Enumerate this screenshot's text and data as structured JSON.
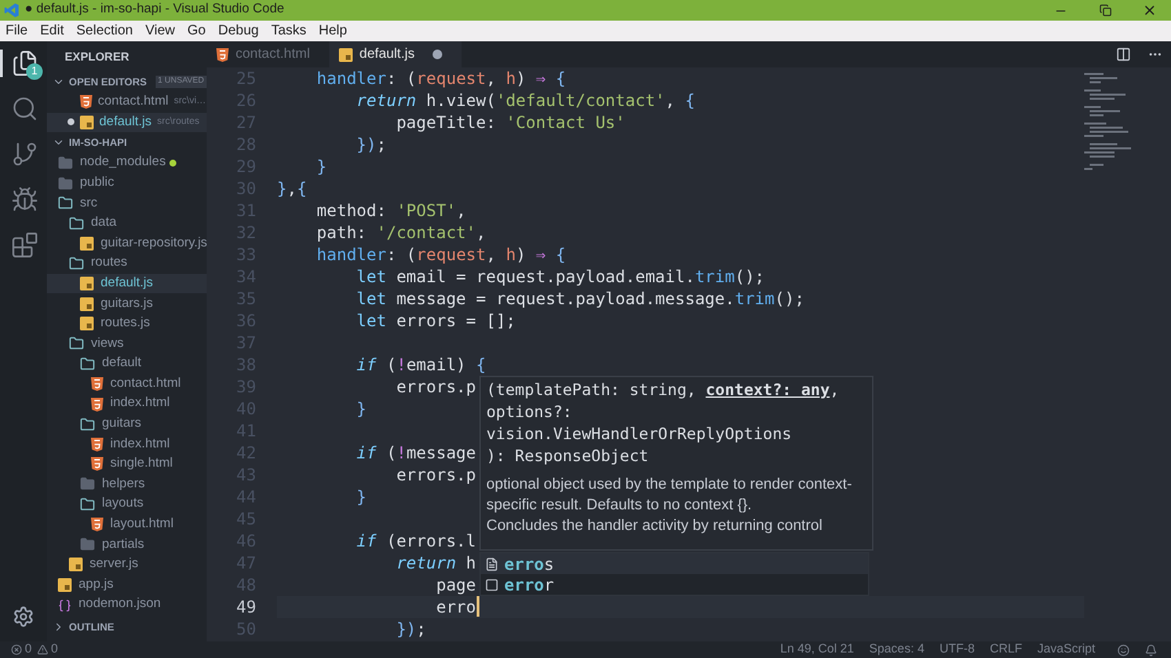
{
  "window": {
    "title": "● default.js - im-so-hapi - Visual Studio Code"
  },
  "menu": [
    "File",
    "Edit",
    "Selection",
    "View",
    "Go",
    "Debug",
    "Tasks",
    "Help"
  ],
  "activity_bar": [
    {
      "kind": "files",
      "selected": true,
      "badge": "1"
    },
    {
      "kind": "search",
      "selected": false
    },
    {
      "kind": "source-control",
      "selected": false
    },
    {
      "kind": "debug",
      "selected": false
    },
    {
      "kind": "extensions",
      "selected": false
    }
  ],
  "sidebar": {
    "title": "EXPLORER",
    "open_editors": {
      "title": "OPEN EDITORS",
      "badge": "1 UNSAVED",
      "expanded": true,
      "items": [
        {
          "name": "contact.html",
          "path": "src\\vi…",
          "kind": "html",
          "dirty": false,
          "selected": false
        },
        {
          "name": "default.js",
          "path": "src\\routes",
          "kind": "js",
          "dirty": true,
          "selected": true
        }
      ]
    },
    "project": {
      "title": "IM-SO-HAPI",
      "expanded": true,
      "items": [
        {
          "name": "node_modules",
          "kind": "folder",
          "expanded": false,
          "selected": false,
          "color": "#a6d33b"
        },
        {
          "name": "public",
          "kind": "folder",
          "expanded": false,
          "selected": false
        },
        {
          "name": "src",
          "kind": "folder",
          "expanded": true,
          "selected": false,
          "children": [
            {
              "name": "data",
              "kind": "folder",
              "expanded": true,
              "selected": false,
              "children": [
                {
                  "name": "guitar-repository.js",
                  "kind": "js",
                  "selected": false
                }
              ]
            },
            {
              "name": "routes",
              "kind": "folder",
              "expanded": true,
              "selected": false,
              "children": [
                {
                  "name": "default.js",
                  "kind": "js",
                  "selected": true
                },
                {
                  "name": "guitars.js",
                  "kind": "js",
                  "selected": false
                },
                {
                  "name": "routes.js",
                  "kind": "js",
                  "selected": false
                }
              ]
            },
            {
              "name": "views",
              "kind": "folder",
              "expanded": true,
              "selected": false,
              "children": [
                {
                  "name": "default",
                  "kind": "folder",
                  "expanded": true,
                  "selected": false,
                  "children": [
                    {
                      "name": "contact.html",
                      "kind": "html",
                      "selected": false
                    },
                    {
                      "name": "index.html",
                      "kind": "html",
                      "selected": false
                    }
                  ]
                },
                {
                  "name": "guitars",
                  "kind": "folder",
                  "expanded": true,
                  "selected": false,
                  "children": [
                    {
                      "name": "index.html",
                      "kind": "html",
                      "selected": false
                    },
                    {
                      "name": "single.html",
                      "kind": "html",
                      "selected": false
                    }
                  ]
                },
                {
                  "name": "helpers",
                  "kind": "folder",
                  "expanded": false,
                  "selected": false
                },
                {
                  "name": "layouts",
                  "kind": "folder",
                  "expanded": true,
                  "selected": false,
                  "children": [
                    {
                      "name": "layout.html",
                      "kind": "html",
                      "selected": false
                    }
                  ]
                },
                {
                  "name": "partials",
                  "kind": "folder",
                  "expanded": false,
                  "selected": false
                }
              ]
            },
            {
              "name": "server.js",
              "kind": "js",
              "selected": false
            }
          ]
        },
        {
          "name": "app.js",
          "kind": "js",
          "selected": false
        },
        {
          "name": "nodemon.json",
          "kind": "json",
          "selected": false
        }
      ]
    },
    "outline": {
      "title": "OUTLINE",
      "expanded": false
    }
  },
  "tabs": [
    {
      "label": "contact.html",
      "kind": "html",
      "selected": false,
      "dirty": false
    },
    {
      "label": "default.js",
      "kind": "js",
      "selected": true,
      "dirty": true
    }
  ],
  "editor": {
    "lines": [
      {
        "number": "25",
        "current": false,
        "tokens": [
          {
            "text": "    handler",
            "kind": "f"
          },
          {
            "text": ": (",
            "kind": "t"
          },
          {
            "text": "request",
            "kind": "p"
          },
          {
            "text": ", ",
            "kind": "t"
          },
          {
            "text": "h",
            "kind": "p"
          },
          {
            "text": ")",
            "kind": "t"
          },
          {
            "text": " ⇒ ",
            "kind": "o"
          },
          {
            "text": "{",
            "kind": "b"
          }
        ]
      },
      {
        "number": "26",
        "current": false,
        "tokens": [
          {
            "text": "        return",
            "kind": "i"
          },
          {
            "text": " h.view(",
            "kind": "t"
          },
          {
            "text": "'default/contact'",
            "kind": "s"
          },
          {
            "text": ", ",
            "kind": "t"
          },
          {
            "text": "{",
            "kind": "b"
          }
        ]
      },
      {
        "number": "27",
        "current": false,
        "tokens": [
          {
            "text": "            pageTitle: ",
            "kind": "t"
          },
          {
            "text": "'Contact Us'",
            "kind": "s"
          }
        ]
      },
      {
        "number": "28",
        "current": false,
        "tokens": [
          {
            "text": "        })",
            "kind": "b"
          },
          {
            "text": ";",
            "kind": "t"
          }
        ]
      },
      {
        "number": "29",
        "current": false,
        "tokens": [
          {
            "text": "    }",
            "kind": "b"
          }
        ]
      },
      {
        "number": "30",
        "current": false,
        "tokens": [
          {
            "text": "}",
            "kind": "b"
          },
          {
            "text": ",",
            "kind": "t"
          },
          {
            "text": "{",
            "kind": "b"
          }
        ]
      },
      {
        "number": "31",
        "current": false,
        "tokens": [
          {
            "text": "    method: ",
            "kind": "t"
          },
          {
            "text": "'POST'",
            "kind": "s"
          },
          {
            "text": ",",
            "kind": "t"
          }
        ]
      },
      {
        "number": "32",
        "current": false,
        "tokens": [
          {
            "text": "    path: ",
            "kind": "t"
          },
          {
            "text": "'/contact'",
            "kind": "s"
          },
          {
            "text": ",",
            "kind": "t"
          }
        ]
      },
      {
        "number": "33",
        "current": false,
        "tokens": [
          {
            "text": "    handler",
            "kind": "f"
          },
          {
            "text": ": (",
            "kind": "t"
          },
          {
            "text": "request",
            "kind": "p"
          },
          {
            "text": ", ",
            "kind": "t"
          },
          {
            "text": "h",
            "kind": "p"
          },
          {
            "text": ")",
            "kind": "t"
          },
          {
            "text": " ⇒ ",
            "kind": "o"
          },
          {
            "text": "{",
            "kind": "b"
          }
        ]
      },
      {
        "number": "34",
        "current": false,
        "tokens": [
          {
            "text": "        let",
            "kind": "k"
          },
          {
            "text": " email = request.payload.email.",
            "kind": "t"
          },
          {
            "text": "trim",
            "kind": "f"
          },
          {
            "text": "();",
            "kind": "t"
          }
        ]
      },
      {
        "number": "35",
        "current": false,
        "tokens": [
          {
            "text": "        let",
            "kind": "k"
          },
          {
            "text": " message = request.payload.message.",
            "kind": "t"
          },
          {
            "text": "trim",
            "kind": "f"
          },
          {
            "text": "();",
            "kind": "t"
          }
        ]
      },
      {
        "number": "36",
        "current": false,
        "tokens": [
          {
            "text": "        let",
            "kind": "k"
          },
          {
            "text": " errors = [];",
            "kind": "t"
          }
        ]
      },
      {
        "number": "37",
        "current": false
      },
      {
        "number": "38",
        "current": false,
        "tokens": [
          {
            "text": "        if",
            "kind": "i"
          },
          {
            "text": " (",
            "kind": "t"
          },
          {
            "text": "!",
            "kind": "o"
          },
          {
            "text": "email) ",
            "kind": "t"
          },
          {
            "text": "{",
            "kind": "b"
          }
        ]
      },
      {
        "number": "39",
        "current": false,
        "tokens": [
          {
            "text": "            errors.p",
            "kind": "t"
          }
        ]
      },
      {
        "number": "40",
        "current": false,
        "tokens": [
          {
            "text": "        }",
            "kind": "b"
          }
        ]
      },
      {
        "number": "41",
        "current": false
      },
      {
        "number": "42",
        "current": false,
        "tokens": [
          {
            "text": "        if",
            "kind": "i"
          },
          {
            "text": " (",
            "kind": "t"
          },
          {
            "text": "!",
            "kind": "o"
          },
          {
            "text": "message",
            "kind": "t"
          }
        ]
      },
      {
        "number": "43",
        "current": false,
        "tokens": [
          {
            "text": "            errors.p",
            "kind": "t"
          }
        ]
      },
      {
        "number": "44",
        "current": false,
        "tokens": [
          {
            "text": "        }",
            "kind": "b"
          }
        ]
      },
      {
        "number": "45",
        "current": false
      },
      {
        "number": "46",
        "current": false,
        "tokens": [
          {
            "text": "        if",
            "kind": "i"
          },
          {
            "text": " (errors.l",
            "kind": "t"
          }
        ]
      },
      {
        "number": "47",
        "current": false,
        "tokens": [
          {
            "text": "            return",
            "kind": "i"
          },
          {
            "text": " h",
            "kind": "t"
          }
        ]
      },
      {
        "number": "48",
        "current": false,
        "tokens": [
          {
            "text": "                page",
            "kind": "t"
          }
        ]
      },
      {
        "number": "49",
        "current": true,
        "tokens": [
          {
            "text": "                erro",
            "kind": "t"
          }
        ]
      },
      {
        "number": "50",
        "current": false,
        "tokens": [
          {
            "text": "            })",
            "kind": "b"
          },
          {
            "text": ";",
            "kind": "t"
          }
        ]
      }
    ]
  },
  "hover": {
    "signature": [
      "(templatePath: string, **context?: any**,",
      "options?:",
      "vision.ViewHandlerOrReplyOptions",
      "): ResponseObject"
    ],
    "doc": [
      "optional object used by the template to render context-specific result. Defaults to no context {}.",
      "Concludes the handler activity by returning control"
    ]
  },
  "suggestions": [
    {
      "match": "erro",
      "rest": "s",
      "kind": "file",
      "selected": true
    },
    {
      "match": "erro",
      "rest": "r",
      "kind": "variable",
      "selected": false
    }
  ],
  "status_bar": {
    "errors": "0",
    "warnings": "0",
    "items": [
      "Ln 49, Col 21",
      "Spaces: 4",
      "UTF-8",
      "CRLF",
      "JavaScript"
    ]
  }
}
